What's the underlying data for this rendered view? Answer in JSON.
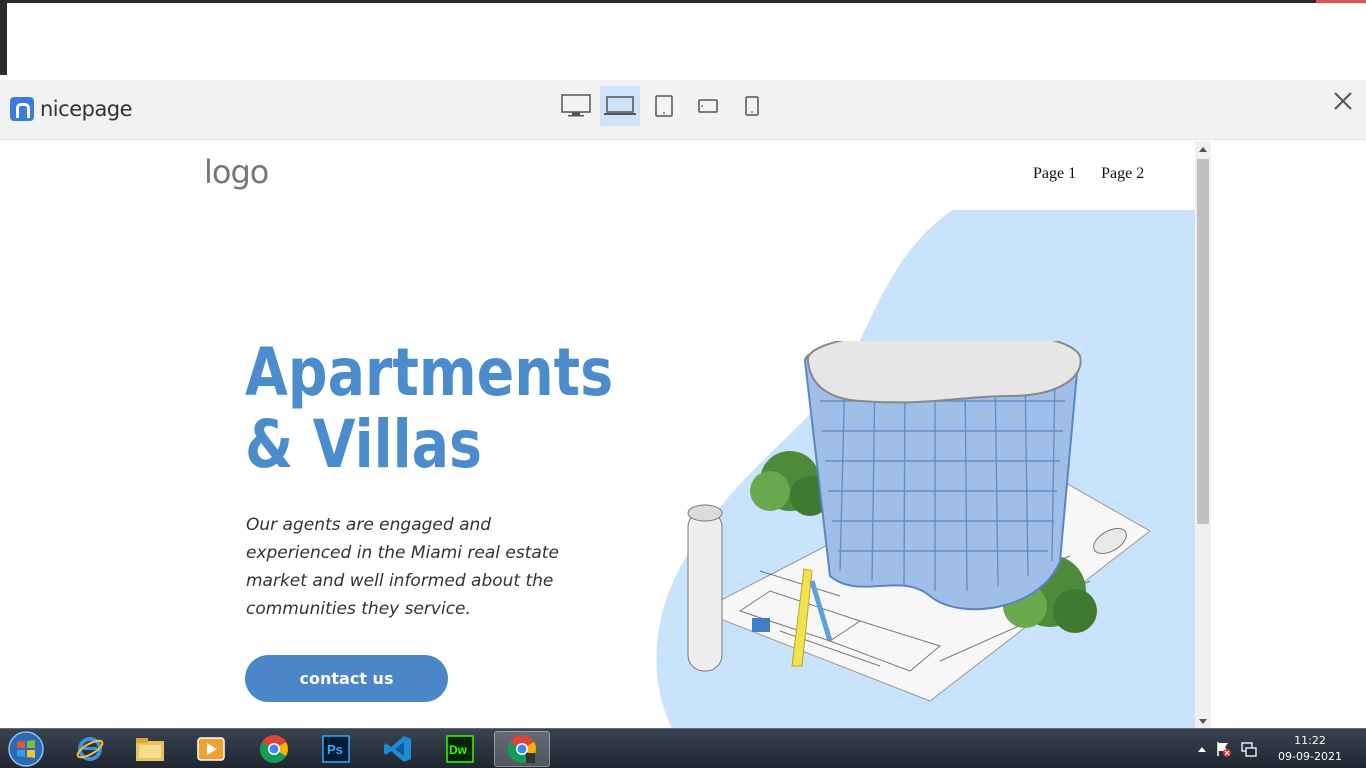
{
  "toolbar": {
    "brand_name": "nicepage",
    "devices": [
      "desktop-icon",
      "laptop-icon",
      "tablet-icon",
      "tablet-landscape-icon",
      "phone-icon"
    ],
    "active_device": "laptop-icon",
    "close": "close-icon"
  },
  "site": {
    "logo": "logo",
    "nav": [
      "Page 1",
      "Page 2"
    ],
    "hero": {
      "title_line1": "Apartments",
      "title_line2": "& Villas",
      "text": "Our agents are engaged and experienced in the Miami real estate market and well informed about the communities they service.",
      "button": "contact us"
    }
  },
  "colors": {
    "accent": "#4a8ccc",
    "button": "#4a86c8",
    "blob": "#c9e3fc",
    "toolbar_bg": "#f2f2f2",
    "active_device_bg": "#cfe3fb"
  },
  "taskbar": {
    "apps": [
      "internet-explorer-icon",
      "file-explorer-icon",
      "media-player-icon",
      "chrome-icon",
      "photoshop-icon",
      "vscode-icon",
      "dreamweaver-icon",
      "chrome-active-icon"
    ],
    "photoshop_label": "Ps",
    "dreamweaver_label": "Dw",
    "time": "11:22",
    "date": "09-09-2021"
  }
}
